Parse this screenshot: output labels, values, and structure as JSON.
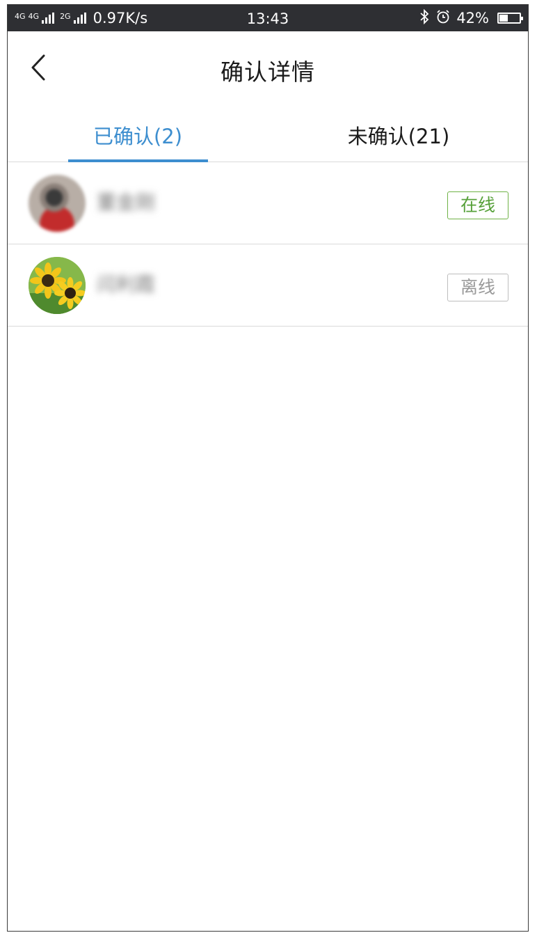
{
  "status_bar": {
    "network_1": "4G",
    "network_2": "4G",
    "network_3": "2G",
    "speed": "0.97K/s",
    "time": "13:43",
    "battery": "42%",
    "battery_level": 0.42
  },
  "header": {
    "title": "确认详情"
  },
  "tabs": [
    {
      "label": "已确认(2)",
      "active": true
    },
    {
      "label": "未确认(21)",
      "active": false
    }
  ],
  "users": [
    {
      "name": "董金刚",
      "status": "在线",
      "online": true
    },
    {
      "name": "闫利霞",
      "status": "离线",
      "online": false
    }
  ],
  "colors": {
    "accent": "#3d8ecf",
    "online": "#57a13a",
    "offline": "#9a9a9a",
    "status_bar_bg": "#2e2f33"
  }
}
